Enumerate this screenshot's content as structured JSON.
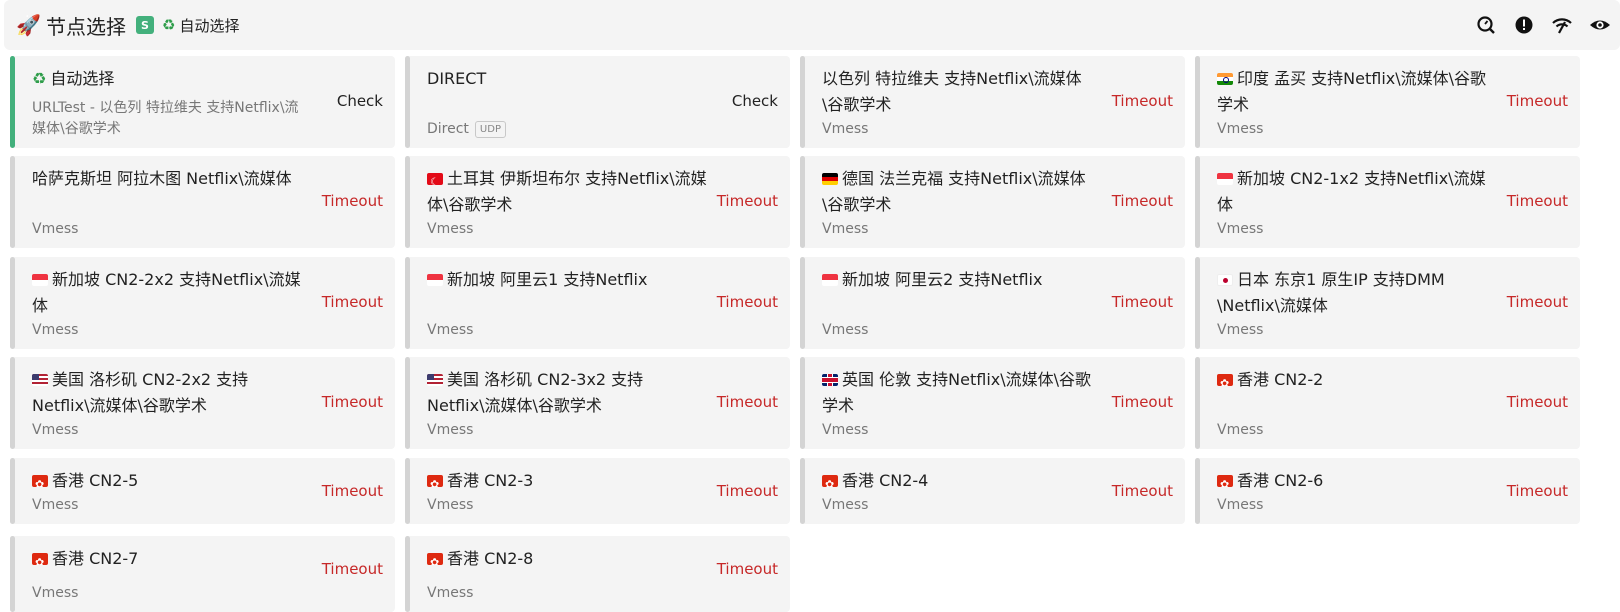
{
  "header": {
    "title": "节点选择",
    "badge": "S",
    "current_selection": "自动选择",
    "icons": [
      "rocket-icon",
      "recycle-icon",
      "speed-test-icon",
      "alert-icon",
      "wifi-icon",
      "eye-icon"
    ]
  },
  "cards": [
    {
      "name": "自动选择",
      "proto": "URLTest - 以色列 特拉维夫 支持Netflix\\流媒体\\谷歌学术",
      "status": "Check",
      "icon": "recycle",
      "active": true
    },
    {
      "name": "DIRECT",
      "proto": "Direct",
      "udp": "UDP",
      "status": "Check",
      "icon": ""
    },
    {
      "name": "以色列 特拉维夫 支持Netflix\\流媒体\\谷歌学术",
      "proto": "Vmess",
      "status": "Timeout",
      "icon": ""
    },
    {
      "name": "印度 孟买 支持Netflix\\流媒体\\谷歌学术",
      "proto": "Vmess",
      "status": "Timeout",
      "icon": "in"
    },
    {
      "name": "哈萨克斯坦 阿拉木图 Netflix\\流媒体",
      "proto": "Vmess",
      "status": "Timeout",
      "icon": ""
    },
    {
      "name": "土耳其 伊斯坦布尔 支持Netflix\\流媒体\\谷歌学术",
      "proto": "Vmess",
      "status": "Timeout",
      "icon": "tr"
    },
    {
      "name": "德国 法兰克福 支持Netflix\\流媒体\\谷歌学术",
      "proto": "Vmess",
      "status": "Timeout",
      "icon": "de"
    },
    {
      "name": "新加坡 CN2-1x2 支持Netflix\\流媒体",
      "proto": "Vmess",
      "status": "Timeout",
      "icon": "sg"
    },
    {
      "name": "新加坡 CN2-2x2 支持Netflix\\流媒体",
      "proto": "Vmess",
      "status": "Timeout",
      "icon": "sg"
    },
    {
      "name": "新加坡 阿里云1 支持Netflix",
      "proto": "Vmess",
      "status": "Timeout",
      "icon": "sg"
    },
    {
      "name": "新加坡 阿里云2 支持Netflix",
      "proto": "Vmess",
      "status": "Timeout",
      "icon": "sg"
    },
    {
      "name": "日本 东京1 原生IP 支持DMM \\Netflix\\流媒体",
      "proto": "Vmess",
      "status": "Timeout",
      "icon": "jp"
    },
    {
      "name": "美国 洛杉矶 CN2-2x2 支持Netflix\\流媒体\\谷歌学术",
      "proto": "Vmess",
      "status": "Timeout",
      "icon": "us"
    },
    {
      "name": "美国 洛杉矶 CN2-3x2 支持Netflix\\流媒体\\谷歌学术",
      "proto": "Vmess",
      "status": "Timeout",
      "icon": "us"
    },
    {
      "name": "英国 伦敦 支持Netflix\\流媒体\\谷歌学术",
      "proto": "Vmess",
      "status": "Timeout",
      "icon": "gb"
    },
    {
      "name": "香港 CN2-2",
      "proto": "Vmess",
      "status": "Timeout",
      "icon": "hk"
    },
    {
      "name": "香港 CN2-5",
      "proto": "Vmess",
      "status": "Timeout",
      "icon": "hk"
    },
    {
      "name": "香港 CN2-3",
      "proto": "Vmess",
      "status": "Timeout",
      "icon": "hk"
    },
    {
      "name": "香港 CN2-4",
      "proto": "Vmess",
      "status": "Timeout",
      "icon": "hk"
    },
    {
      "name": "香港 CN2-6",
      "proto": "Vmess",
      "status": "Timeout",
      "icon": "hk"
    },
    {
      "name": "香港 CN2-7",
      "proto": "Vmess",
      "status": "Timeout",
      "icon": "hk"
    },
    {
      "name": "香港 CN2-8",
      "proto": "Vmess",
      "status": "Timeout",
      "icon": "hk"
    }
  ],
  "colors": {
    "active_accent": "#43b07c",
    "timeout": "#c62828",
    "card_bg": "#f4f4f4"
  }
}
